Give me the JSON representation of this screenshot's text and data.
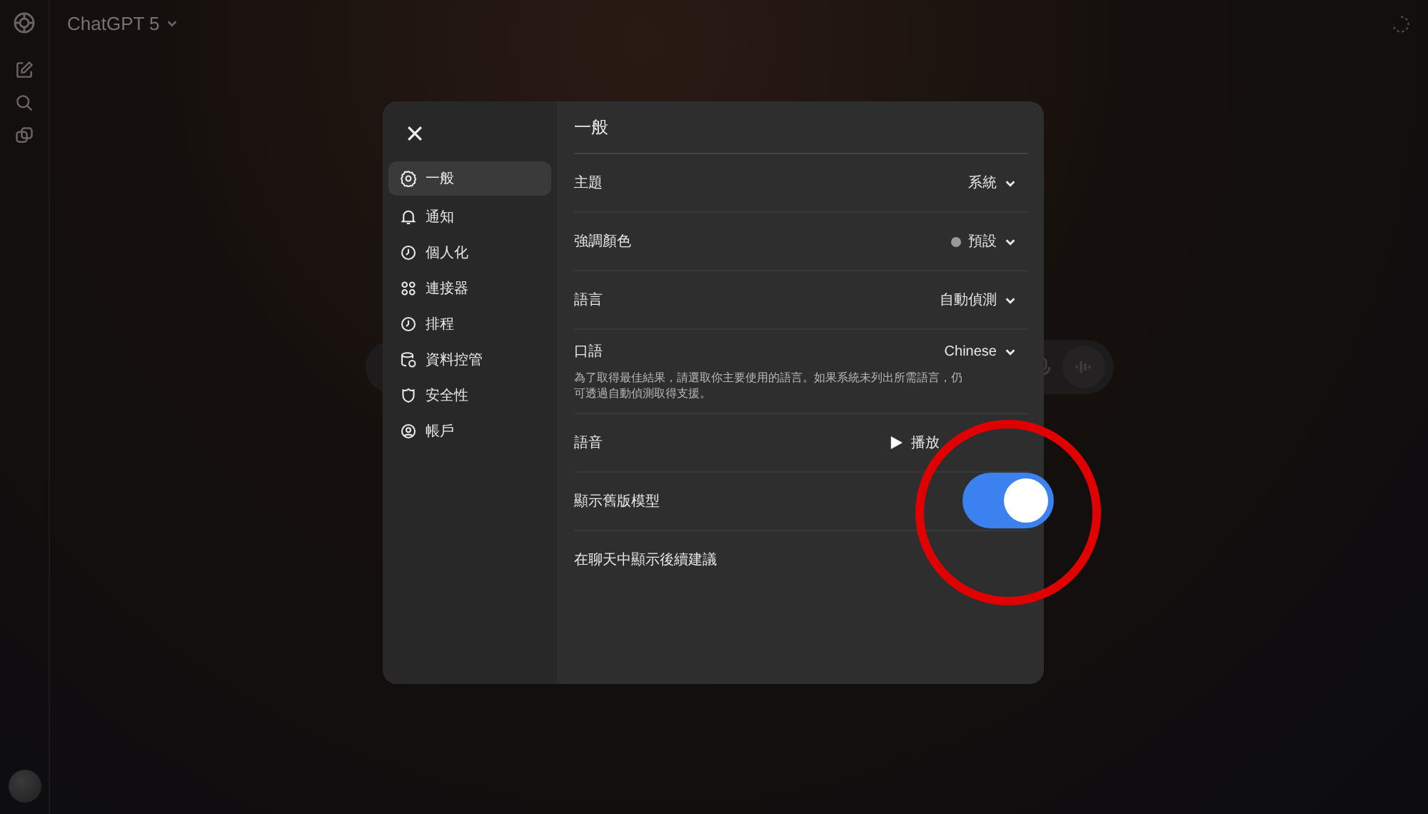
{
  "app_header": {
    "title": "ChatGPT 5"
  },
  "settings": {
    "nav": [
      {
        "label": "一般",
        "selected": true
      },
      {
        "label": "通知",
        "selected": false
      },
      {
        "label": "個人化",
        "selected": false
      },
      {
        "label": "連接器",
        "selected": false
      },
      {
        "label": "排程",
        "selected": false
      },
      {
        "label": "資料控管",
        "selected": false
      },
      {
        "label": "安全性",
        "selected": false
      },
      {
        "label": "帳戶",
        "selected": false
      }
    ],
    "heading": "一般",
    "rows": [
      {
        "kind": "select",
        "label": "主題",
        "value": "系統"
      },
      {
        "kind": "select",
        "label": "強調顏色",
        "value": "預設",
        "color": "#9a9a9a"
      },
      {
        "kind": "select",
        "label": "語言",
        "value": "自動偵測"
      },
      {
        "kind": "select",
        "label": "口語",
        "value": "Chinese",
        "description": "為了取得最佳結果，請選取你主要使用的語言。如果系統未列出所需語言，仍可透過自動偵測取得支援。"
      },
      {
        "kind": "play",
        "label": "語音",
        "value": "播放"
      },
      {
        "kind": "toggle",
        "label": "顯示舊版模型",
        "on": true
      },
      {
        "kind": "plain",
        "label": "在聊天中顯示後續建議"
      }
    ]
  }
}
